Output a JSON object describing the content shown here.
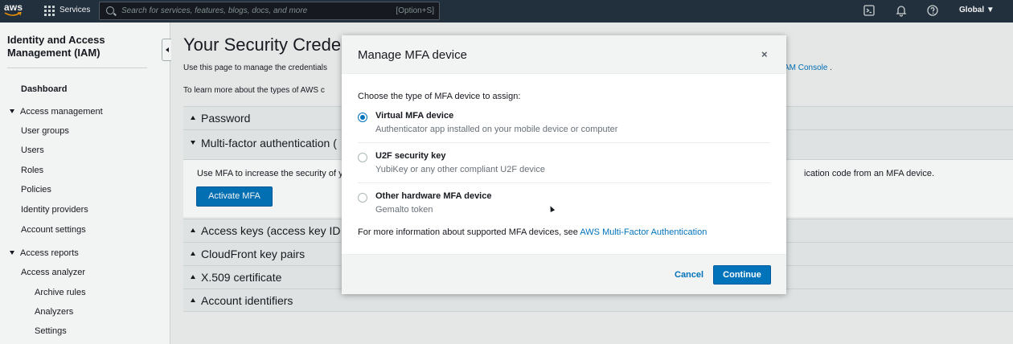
{
  "topnav": {
    "logo_text": "aws",
    "services_label": "Services",
    "search_placeholder": "Search for services, features, blogs, docs, and more",
    "search_shortcut": "[Option+S]",
    "region": "Global ▼",
    "icons": [
      "grid-icon",
      "search-icon",
      "cloudshell-icon",
      "bell-icon",
      "help-icon"
    ]
  },
  "sidebar": {
    "title": "Identity and Access Management (IAM)",
    "items": [
      {
        "label": "Dashboard",
        "bold": true
      },
      {
        "label": "Access management",
        "section": true
      },
      {
        "label": "User groups"
      },
      {
        "label": "Users"
      },
      {
        "label": "Roles"
      },
      {
        "label": "Policies"
      },
      {
        "label": "Identity providers"
      },
      {
        "label": "Account settings"
      },
      {
        "label": "Access reports",
        "section": true
      },
      {
        "label": "Access analyzer"
      },
      {
        "label": "Archive rules"
      },
      {
        "label": "Analyzers"
      },
      {
        "label": "Settings"
      }
    ]
  },
  "main": {
    "title": "Your Security Crede",
    "desc1": "Use this page to manage the credentials",
    "desc1_link": "AM Console",
    "desc1_end": ".",
    "desc2": "To learn more about the types of AWS c",
    "sections": {
      "password": "Password",
      "mfa": "Multi-factor authentication (",
      "access_keys": "Access keys (access key ID",
      "cloudfront": "CloudFront key pairs",
      "x509": "X.509 certificate",
      "account_ids": "Account identifiers"
    },
    "mfa_text": "Use MFA to increase the security of y",
    "mfa_text_right": "ication code from an MFA device.",
    "activate_button": "Activate MFA"
  },
  "modal": {
    "title": "Manage MFA device",
    "close": "×",
    "prompt": "Choose the type of MFA device to assign:",
    "options": [
      {
        "name": "Virtual MFA device",
        "sub": "Authenticator app installed on your mobile device or computer",
        "selected": true
      },
      {
        "name": "U2F security key",
        "sub": "YubiKey or any other compliant U2F device",
        "selected": false
      },
      {
        "name": "Other hardware MFA device",
        "sub": "Gemalto token",
        "selected": false
      }
    ],
    "more_info": "For more information about supported MFA devices, see ",
    "more_info_link": "AWS Multi-Factor Authentication",
    "cancel": "Cancel",
    "continue": "Continue"
  },
  "colors": {
    "nav_bg": "#232f3e",
    "accent": "#0073bb",
    "page_bg": "#f2f3f3"
  }
}
